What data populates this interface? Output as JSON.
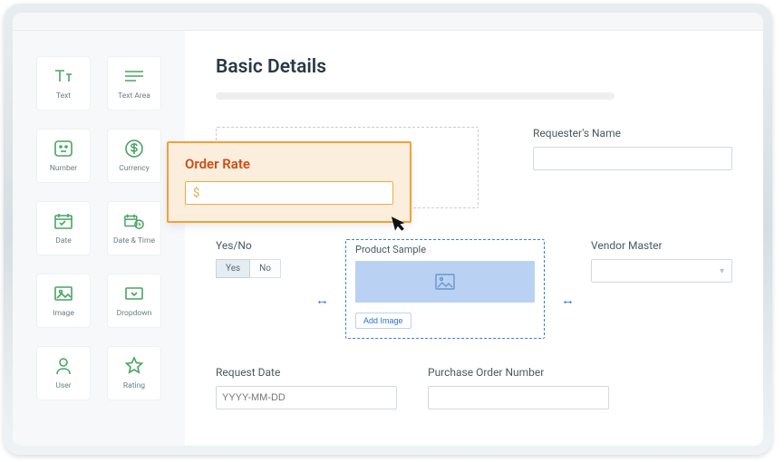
{
  "palette": {
    "text": "Text",
    "textarea": "Text Area",
    "number": "Number",
    "currency": "Currency",
    "date": "Date",
    "datetime": "Date & Time",
    "image": "Image",
    "dropdown": "Dropdown",
    "user": "User",
    "rating": "Rating"
  },
  "page": {
    "title": "Basic Details"
  },
  "fields": {
    "requester_label": "Requester's Name",
    "yesno_label": "Yes/No",
    "yes": "Yes",
    "no": "No",
    "product_sample_label": "Product Sample",
    "add_image": "Add Image",
    "vendor_master_label": "Vendor Master",
    "request_date_label": "Request Date",
    "request_date_placeholder": "YYYY-MM-DD",
    "po_number_label": "Purchase Order Number"
  },
  "overlay": {
    "title": "Order Rate",
    "prefix": "$"
  }
}
